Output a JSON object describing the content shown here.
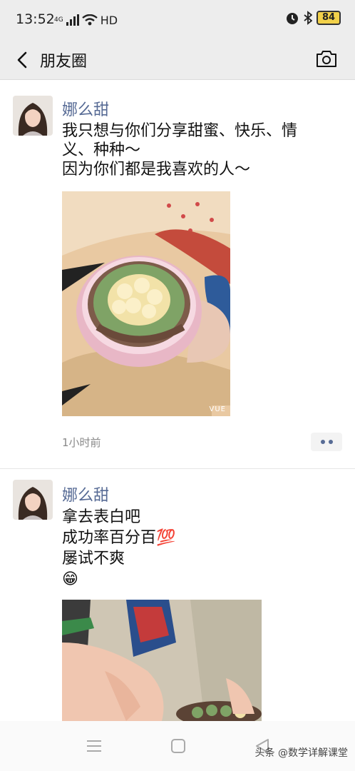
{
  "status_bar": {
    "time": "13:52",
    "network": "4G",
    "hd": "HD",
    "battery": "84"
  },
  "nav": {
    "title": "朋友圈"
  },
  "posts": [
    {
      "username": "娜么甜",
      "text": "我只想与你们分享甜蜜、快乐、情\n义、种种～\n因为你们都是我喜欢的人～",
      "photo_watermark": "VUE",
      "timestamp": "1小时前"
    },
    {
      "username": "娜么甜",
      "text": "拿去表白吧\n成功率百分百💯\n屡试不爽\n😁"
    }
  ],
  "watermark": "头条 @数学详解课堂"
}
